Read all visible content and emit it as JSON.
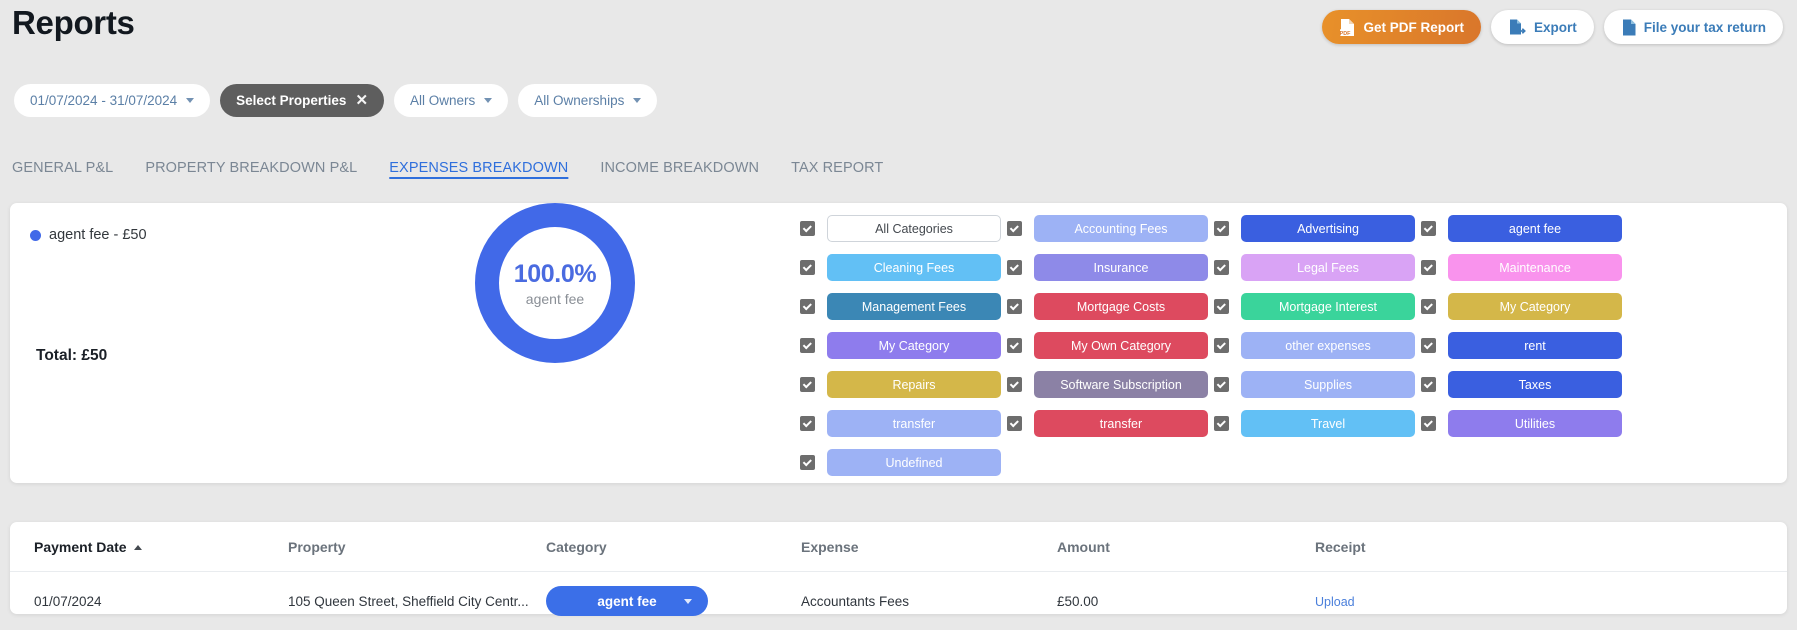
{
  "header": {
    "title": "Reports",
    "actions": [
      {
        "label": "Get PDF Report",
        "icon": "pdf-file-icon",
        "style": "orange"
      },
      {
        "label": "Export",
        "icon": "export-file-icon",
        "style": "white"
      },
      {
        "label": "File your tax return",
        "icon": "document-icon",
        "style": "white"
      }
    ]
  },
  "filters": [
    {
      "label": "01/07/2024 - 31/07/2024",
      "icon": "chevron-down-icon",
      "active": false
    },
    {
      "label": "Select Properties",
      "icon": "close-icon",
      "active": true
    },
    {
      "label": "All Owners",
      "icon": "chevron-down-icon",
      "active": false
    },
    {
      "label": "All Ownerships",
      "icon": "chevron-down-icon",
      "active": false
    }
  ],
  "tabs": [
    {
      "label": "GENERAL P&L",
      "active": false
    },
    {
      "label": "PROPERTY BREAKDOWN P&L",
      "active": false
    },
    {
      "label": "EXPENSES BREAKDOWN",
      "active": true
    },
    {
      "label": "INCOME BREAKDOWN",
      "active": false
    },
    {
      "label": "TAX REPORT",
      "active": false
    }
  ],
  "chart_data": {
    "type": "pie",
    "title": "",
    "subtype": "donut",
    "labels": [
      "agent fee"
    ],
    "values": [
      50
    ],
    "percentages": [
      100.0
    ],
    "colors": [
      "#4169e8"
    ],
    "currency": "£",
    "center_value": "100.0%",
    "center_label": "agent fee",
    "legend": [
      {
        "label": "agent fee - £50",
        "color": "#4169e8"
      }
    ],
    "legend_position": "top-left",
    "total_label": "Total: £50",
    "total_value": 50
  },
  "categories": {
    "accent_checkbox": "#6d6d6d",
    "items": [
      {
        "label": "All Categories",
        "color": "#ffffff",
        "plain": true,
        "checked": true
      },
      {
        "label": "Accounting Fees",
        "color": "#9db2f5",
        "checked": true
      },
      {
        "label": "Advertising",
        "color": "#3a5fe0",
        "checked": true
      },
      {
        "label": "agent fee",
        "color": "#3a5fe0",
        "checked": true
      },
      {
        "label": "Cleaning Fees",
        "color": "#62c0f5",
        "checked": true
      },
      {
        "label": "Insurance",
        "color": "#8e8ae8",
        "checked": true
      },
      {
        "label": "Legal Fees",
        "color": "#d9a3f5",
        "checked": true
      },
      {
        "label": "Maintenance",
        "color": "#f993ed",
        "checked": true
      },
      {
        "label": "Management Fees",
        "color": "#3b87b5",
        "checked": true
      },
      {
        "label": "Mortgage Costs",
        "color": "#dd4a5f",
        "checked": true
      },
      {
        "label": "Mortgage Interest",
        "color": "#3ad49b",
        "checked": true
      },
      {
        "label": "My Category",
        "color": "#d4b749",
        "checked": true
      },
      {
        "label": "My Category",
        "color": "#8e7ced",
        "checked": true
      },
      {
        "label": "My Own Category",
        "color": "#dd4a5f",
        "checked": true
      },
      {
        "label": "other expenses",
        "color": "#9db2f5",
        "checked": true
      },
      {
        "label": "rent",
        "color": "#3a5fe0",
        "checked": true
      },
      {
        "label": "Repairs",
        "color": "#d4b749",
        "checked": true
      },
      {
        "label": "Software Subscription",
        "color": "#8b81a5",
        "checked": true
      },
      {
        "label": "Supplies",
        "color": "#9db2f5",
        "checked": true
      },
      {
        "label": "Taxes",
        "color": "#3a5fe0",
        "checked": true
      },
      {
        "label": "transfer",
        "color": "#9db2f5",
        "checked": true
      },
      {
        "label": "transfer",
        "color": "#dd4a5f",
        "checked": true
      },
      {
        "label": "Travel",
        "color": "#62c0f5",
        "checked": true
      },
      {
        "label": "Utilities",
        "color": "#8e7ced",
        "checked": true
      },
      {
        "label": "Undefined",
        "color": "#9db2f5",
        "checked": true
      }
    ]
  },
  "table": {
    "columns": [
      {
        "label": "Payment Date",
        "sort": "asc"
      },
      {
        "label": "Property",
        "sort": null
      },
      {
        "label": "Category",
        "sort": null
      },
      {
        "label": "Expense",
        "sort": null
      },
      {
        "label": "Amount",
        "sort": null
      },
      {
        "label": "Receipt",
        "sort": null
      }
    ],
    "rows": [
      {
        "payment_date": "01/07/2024",
        "property": "105 Queen Street, Sheffield City Centr...",
        "category": "agent fee",
        "category_color": "#3b6fe8",
        "expense": "Accountants Fees",
        "amount": "£50.00",
        "receipt": "Upload"
      }
    ]
  }
}
